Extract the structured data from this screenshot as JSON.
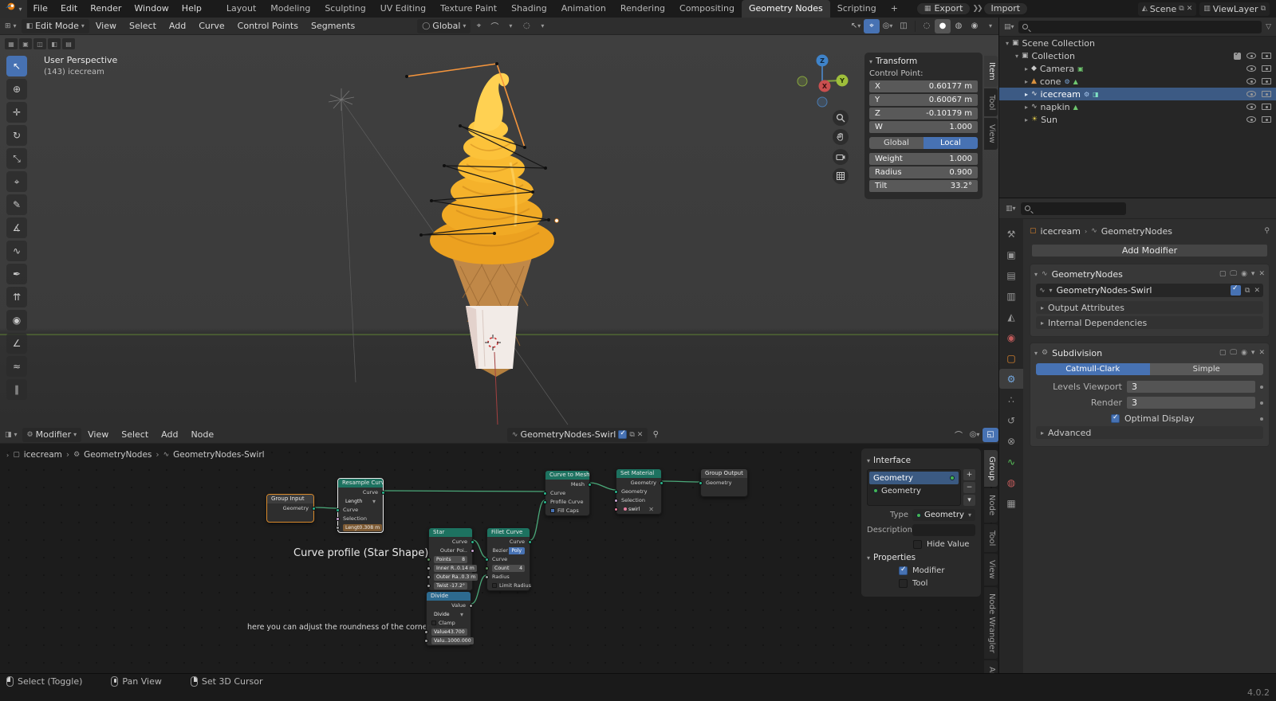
{
  "topbar": {
    "menus": [
      "File",
      "Edit",
      "Render",
      "Window",
      "Help"
    ],
    "workspaces": [
      "Layout",
      "Modeling",
      "Sculpting",
      "UV Editing",
      "Texture Paint",
      "Shading",
      "Animation",
      "Rendering",
      "Compositing",
      "Geometry Nodes",
      "Scripting"
    ],
    "add_tab": "+",
    "export_label": "Export",
    "import_label": "Import",
    "scene_label": "Scene",
    "viewlayer_label": "ViewLayer"
  },
  "viewport": {
    "mode": "Edit Mode",
    "menus": [
      "View",
      "Select",
      "Add",
      "Curve",
      "Control Points",
      "Segments"
    ],
    "orientation": "Global",
    "overlay_line1": "User Perspective",
    "overlay_line2": "(143) icecream",
    "gizmo": {
      "x": "X",
      "y": "Y",
      "z": "Z"
    },
    "tabs": [
      "Item",
      "Tool",
      "View"
    ],
    "transform": {
      "title": "Transform",
      "section": "Control Point:",
      "x_label": "X",
      "x_value": "0.60177 m",
      "y_label": "Y",
      "y_value": "0.60067 m",
      "z_label": "Z",
      "z_value": "-0.10179 m",
      "w_label": "W",
      "w_value": "1.000",
      "global": "Global",
      "local": "Local",
      "weight_label": "Weight",
      "weight_value": "1.000",
      "radius_label": "Radius",
      "radius_value": "0.900",
      "tilt_label": "Tilt",
      "tilt_value": "33.2°"
    }
  },
  "node_editor": {
    "context": "Modifier",
    "menus": [
      "View",
      "Select",
      "Add",
      "Node"
    ],
    "tree_name": "GeometryNodes-Swirl",
    "breadcrumb": [
      "icecream",
      "GeometryNodes",
      "GeometryNodes-Swirl"
    ],
    "annotation1": "Curve profile (Star Shape)",
    "annotation2": "here you can adjust the roundness of the corners -->",
    "nodes": {
      "group_input": {
        "title": "Group Input",
        "out": "Geometry"
      },
      "resample": {
        "title": "Resample Curve",
        "out": "Curve",
        "mode": "Length",
        "in1": "Curve",
        "in2": "Selection",
        "len_label": "Lengt",
        "len_value": "0.308 m"
      },
      "star": {
        "title": "Star",
        "out1": "Curve",
        "out2": "Outer Poi..",
        "p_label": "Points",
        "p_value": "8",
        "ir_label": "Inner R..",
        "ir_value": "0.14 m",
        "or_label": "Outer Ra..",
        "or_value": "0.3 m",
        "tw_label": "Twist",
        "tw_value": "-17.2°"
      },
      "fillet": {
        "title": "Fillet Curve",
        "out": "Curve",
        "bezier": "Bezier",
        "poly": "Poly",
        "in1": "Curve",
        "count_label": "Count",
        "count_value": "4",
        "in2": "Radius",
        "limit": "Limit Radius"
      },
      "divide": {
        "title": "Divide",
        "out": "Value",
        "op": "Divide",
        "clamp": "Clamp",
        "v1_label": "Value",
        "v1_value": "43.700",
        "v2_label": "Valu..",
        "v2_value": "1000.000"
      },
      "curve_to_mesh": {
        "title": "Curve to Mesh",
        "out": "Mesh",
        "in1": "Curve",
        "in2": "Profile Curve",
        "fill": "Fill Caps"
      },
      "set_material": {
        "title": "Set Material",
        "out": "Geometry",
        "in1": "Geometry",
        "in2": "Selection",
        "material": "swirl"
      },
      "group_output": {
        "title": "Group Output",
        "in": "Geometry"
      }
    },
    "sidebar": {
      "interface_title": "Interface",
      "items": [
        "Geometry",
        "Geometry"
      ],
      "type_label": "Type",
      "type_value": "Geometry",
      "description_label": "Description",
      "hide_value": "Hide Value",
      "properties_title": "Properties",
      "modifier": "Modifier",
      "tool": "Tool"
    },
    "tabs": [
      "Group",
      "Node",
      "Tool",
      "View",
      "Node Wrangler",
      "Arrange"
    ]
  },
  "outliner": {
    "rows": [
      {
        "label": "Scene Collection"
      },
      {
        "label": "Collection"
      },
      {
        "label": "Camera"
      },
      {
        "label": "cone"
      },
      {
        "label": "icecream"
      },
      {
        "label": "napkin"
      },
      {
        "label": "Sun"
      }
    ]
  },
  "properties": {
    "crumb1": "icecream",
    "crumb2": "GeometryNodes",
    "add_modifier": "Add Modifier",
    "gn": {
      "name": "GeometryNodes",
      "group": "GeometryNodes-Swirl",
      "section1": "Output Attributes",
      "section2": "Internal Dependencies"
    },
    "subdiv": {
      "name": "Subdivision",
      "catmull": "Catmull-Clark",
      "simple": "Simple",
      "lv_label": "Levels Viewport",
      "lv_value": "3",
      "r_label": "Render",
      "r_value": "3",
      "optimal": "Optimal Display",
      "advanced": "Advanced"
    }
  },
  "statusbar": {
    "item1": "Select (Toggle)",
    "item2": "Pan View",
    "item3": "Set 3D Cursor",
    "version": "4.0.2"
  }
}
